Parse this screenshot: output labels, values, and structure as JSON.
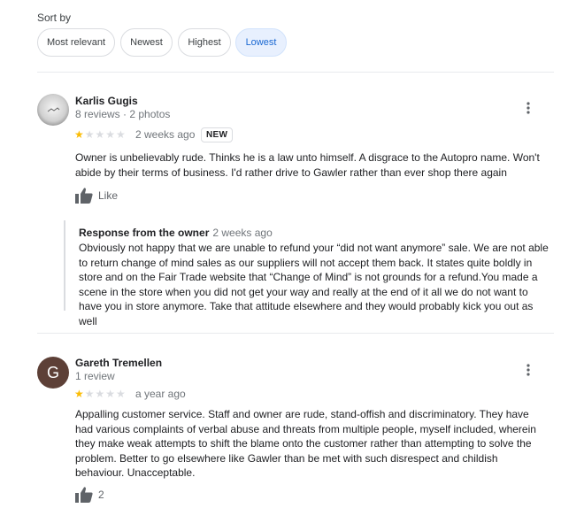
{
  "sort": {
    "label": "Sort by",
    "options": [
      "Most relevant",
      "Newest",
      "Highest",
      "Lowest"
    ],
    "selected": "Lowest"
  },
  "reviews": [
    {
      "author": "Karlis Gugis",
      "meta": "8 reviews · 2 photos",
      "rating": 1,
      "time": "2 weeks ago",
      "badge": "NEW",
      "text": "Owner is unbelievably rude. Thinks he is a law unto himself. A disgrace to the Autopro name. Won't abide by their terms of business. I'd rather drive to Gawler rather than ever shop there again",
      "like_label": "Like",
      "owner_response": {
        "title": "Response from the owner",
        "time": "2 weeks ago",
        "text": "Obviously not happy that we are unable to refund your “did not want anymore” sale. We are not able to return change of mind sales as our suppliers will not accept them back. It states quite boldly in store and on the Fair Trade website that “Change of Mind” is not grounds for a refund.You made a scene in the store when you did not get your way and really at the end of it all we do not want to have you in store anymore. Take that attitude elsewhere and they would probably kick you out as well"
      }
    },
    {
      "author": "Gareth Tremellen",
      "avatar_letter": "G",
      "avatar_color": "#5d4037",
      "meta": "1 review",
      "rating": 1,
      "time": "a year ago",
      "text": "Appalling customer service. Staff and owner are rude, stand-offish and discriminatory. They have had various complaints of verbal abuse and threats from multiple people, myself included, wherein they make weak attempts to shift the blame onto the customer rather than attempting to solve the problem. Better to go elsewhere like Gawler than be met with such disrespect and childish behaviour. Unacceptable.",
      "like_count": "2"
    }
  ],
  "colors": {
    "star": "#fbbc04",
    "chip_active_bg": "#e8f0fe",
    "chip_active_text": "#1967d2"
  }
}
